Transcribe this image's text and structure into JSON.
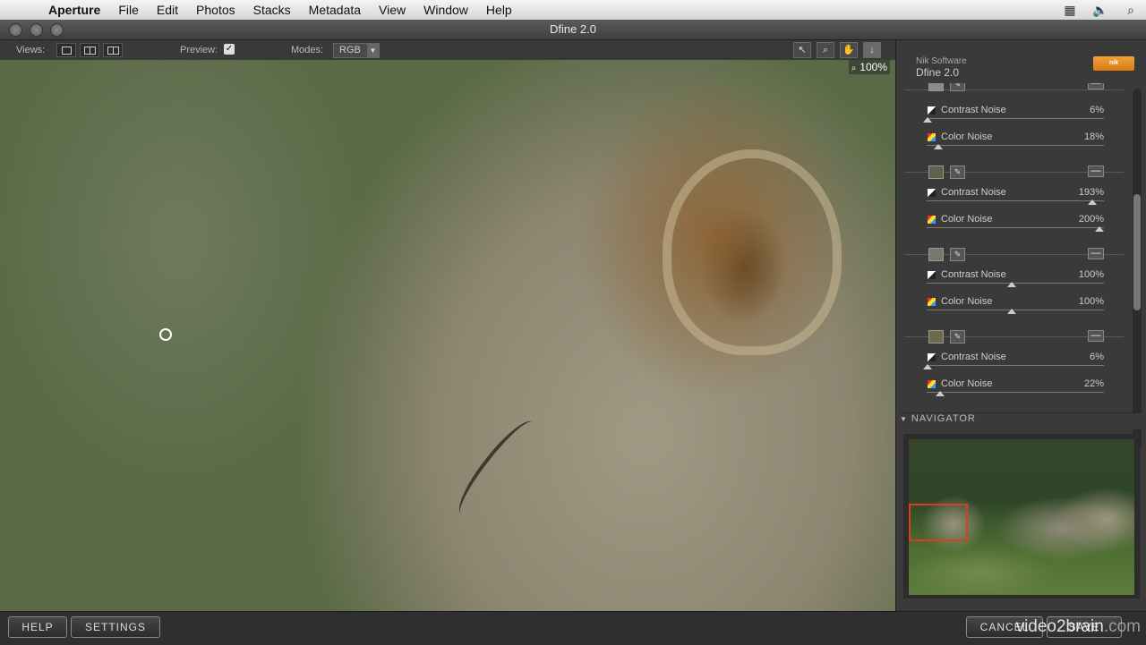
{
  "menubar": {
    "app": "Aperture",
    "items": [
      "File",
      "Edit",
      "Photos",
      "Stacks",
      "Metadata",
      "View",
      "Window",
      "Help"
    ],
    "status_icons": [
      "display-icon",
      "volume-icon",
      "spotlight-icon"
    ]
  },
  "window": {
    "title": "Dfine 2.0"
  },
  "toolbar": {
    "views_label": "Views:",
    "preview_label": "Preview:",
    "preview_checked": "✓",
    "modes_label": "Modes:",
    "mode_value": "RGB",
    "tools": [
      "pointer-icon",
      "zoom-icon",
      "hand-icon",
      "eyedropper-icon"
    ]
  },
  "canvas": {
    "zoom": "100%"
  },
  "panel": {
    "vendor": "Nik Software",
    "product": "Dfine 2.0",
    "logo_text": "nik",
    "groups": [
      {
        "swatch": "#8a8a86",
        "contrast_label": "Contrast Noise",
        "contrast_value": "6%",
        "color_label": "Color Noise",
        "color_value": "18%"
      },
      {
        "swatch": "#5f6148",
        "contrast_label": "Contrast Noise",
        "contrast_value": "193%",
        "color_label": "Color Noise",
        "color_value": "200%"
      },
      {
        "swatch": "#76786a",
        "contrast_label": "Contrast Noise",
        "contrast_value": "100%",
        "color_label": "Color Noise",
        "color_value": "100%"
      },
      {
        "swatch": "#6e6a4a",
        "contrast_label": "Contrast Noise",
        "contrast_value": "6%",
        "color_label": "Color Noise",
        "color_value": "22%"
      }
    ],
    "navigator_label": "NAVIGATOR"
  },
  "bottom": {
    "help_label": "HELP",
    "settings_label": "SETTINGS",
    "cancel_label": "CANCEL",
    "save_label": "SAVE"
  },
  "watermark": {
    "main": "video2brain",
    "suffix": ".com"
  }
}
